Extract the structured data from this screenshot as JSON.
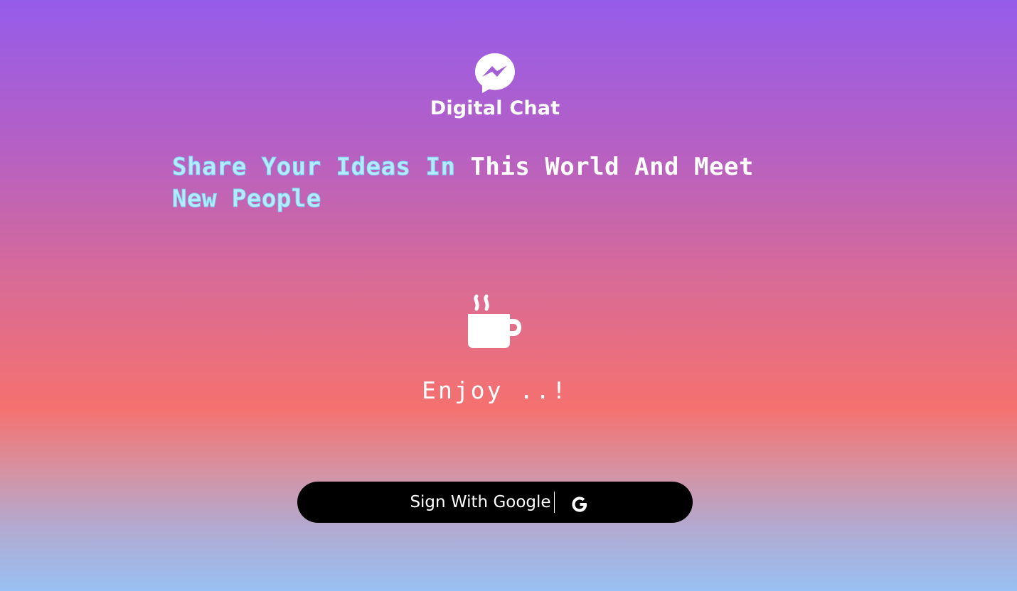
{
  "brand": {
    "logo_icon": "messenger-icon",
    "name": "Digital Chat"
  },
  "tagline": {
    "part_outlined_1": "Share Your Ideas In",
    "part_solid": "This World And Meet",
    "part_outlined_2": "New People"
  },
  "hero": {
    "icon": "coffee-cup-icon",
    "message": "Enjoy ..!"
  },
  "signin": {
    "label": "Sign With Google",
    "icon": "google-icon"
  },
  "colors": {
    "gradient_top": "#955cea",
    "gradient_mid": "#f5716f",
    "gradient_bottom": "#98c0f3",
    "button_bg": "#000000",
    "outline_text": "#b7ecff",
    "text": "#ffffff"
  }
}
